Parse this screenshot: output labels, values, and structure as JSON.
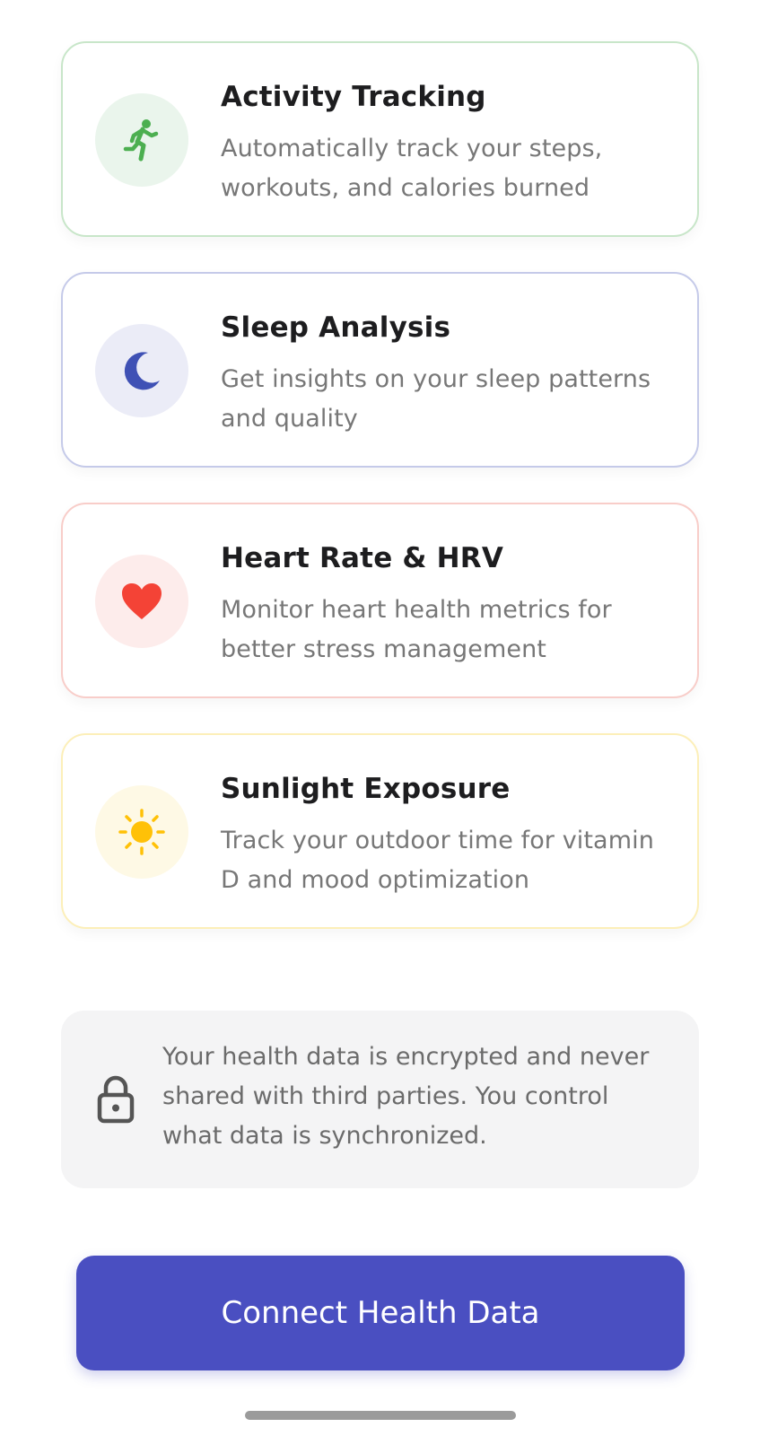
{
  "features": [
    {
      "title": "Activity Tracking",
      "description": "Automatically track your steps, workouts, and calories burned",
      "icon": "running-person-icon",
      "accent": "#4caf50",
      "border": "#c8e6c9",
      "icon_bg": "#eaf5ec"
    },
    {
      "title": "Sleep Analysis",
      "description": "Get insights on your sleep patterns and quality",
      "icon": "moon-icon",
      "accent": "#3f51b5",
      "border": "#c5cae9",
      "icon_bg": "#ebecf7"
    },
    {
      "title": "Heart Rate & HRV",
      "description": "Monitor heart health metrics for better stress management",
      "icon": "heart-icon",
      "accent": "#f44336",
      "border": "#f8cdc9",
      "icon_bg": "#fdeceb"
    },
    {
      "title": "Sunlight Exposure",
      "description": "Track your outdoor time for vitamin D and mood optimization",
      "icon": "sun-icon",
      "accent": "#ffc107",
      "border": "#fcefb9",
      "icon_bg": "#fef9e5"
    }
  ],
  "privacy": {
    "icon": "lock-icon",
    "text": "Your health data is encrypted and never shared with third parties. You control what data is synchronized."
  },
  "connect_button": {
    "label": "Connect Health Data",
    "color": "#4a4fc1"
  }
}
